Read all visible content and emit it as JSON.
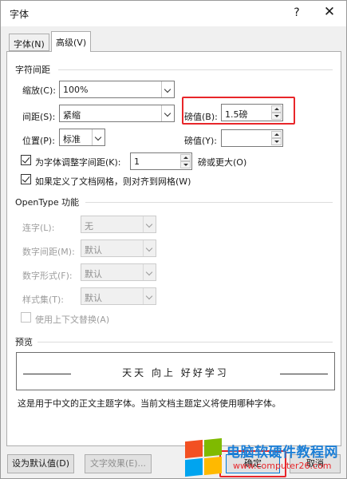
{
  "window": {
    "title": "字体",
    "help_glyph": "?",
    "close_glyph": "✕"
  },
  "tabs": [
    {
      "label": "字体(N)",
      "active": false
    },
    {
      "label": "高级(V)",
      "active": true
    }
  ],
  "char_spacing": {
    "section_title": "字符间距",
    "scale": {
      "label": "缩放(C):",
      "value": "100%"
    },
    "spacing": {
      "label": "间距(S):",
      "value": "紧缩",
      "pt_label": "磅值(B):",
      "pt_value": "1.5磅"
    },
    "position": {
      "label": "位置(P):",
      "value": "标准",
      "pt_label": "磅值(Y):",
      "pt_value": ""
    },
    "kerning": {
      "label": "为字体调整字间距(K):",
      "value": "1",
      "suffix": "磅或更大(O)",
      "checked": true
    },
    "grid_snap": {
      "label": "如果定义了文档网格，则对齐到网格(W)",
      "checked": true
    }
  },
  "opentype": {
    "section_title": "OpenType 功能",
    "ligatures": {
      "label": "连字(L):",
      "value": "无"
    },
    "number_spacing": {
      "label": "数字间距(M):",
      "value": "默认"
    },
    "number_forms": {
      "label": "数字形式(F):",
      "value": "默认"
    },
    "stylistic_sets": {
      "label": "样式集(T):",
      "value": "默认"
    },
    "contextual_alternates": {
      "label": "使用上下文替换(A)",
      "checked": false
    }
  },
  "preview": {
    "section_title": "预览",
    "sample_text": "天天 向上 好好学习",
    "description": "这是用于中文的正文主题字体。当前文档主题定义将使用哪种字体。"
  },
  "buttons": {
    "set_default": "设为默认值(D)",
    "text_effects": "文字效果(E)...",
    "ok": "确定",
    "cancel": "取消"
  },
  "watermark": {
    "title": "电脑软硬件教程网",
    "url": "www.computer26.com"
  },
  "colors": {
    "highlight_red": "#e8262a",
    "watermark_blue": "#1c7fd6"
  }
}
